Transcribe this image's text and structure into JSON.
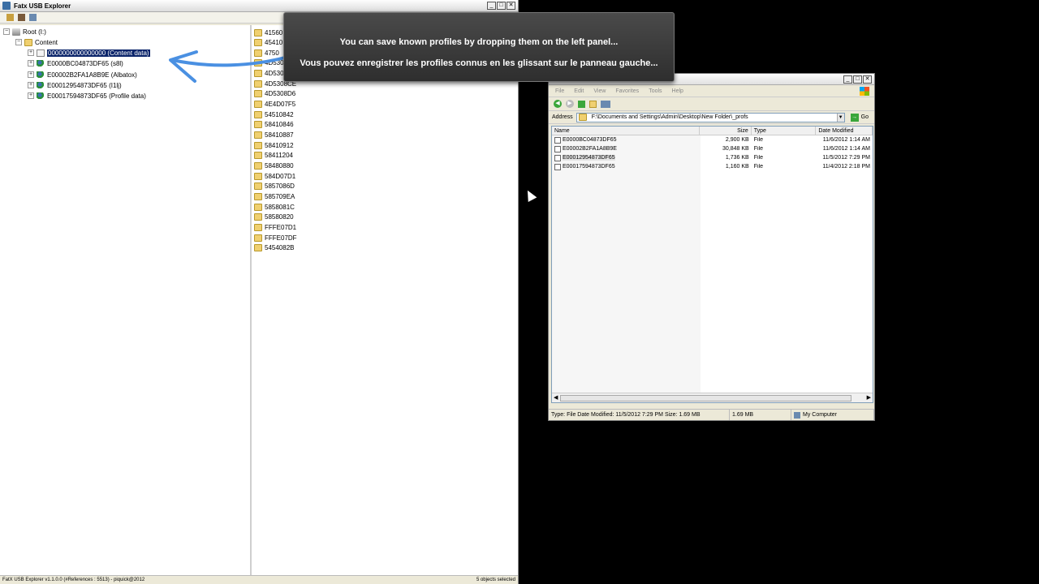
{
  "fatx": {
    "title": "Fatx USB Explorer",
    "tree": {
      "root": "Root (I:)",
      "content": "Content",
      "items": [
        {
          "label": "0000000000000000 (Content data)",
          "icon": "document-icon",
          "selected": true
        },
        {
          "label": "E0000BC04873DF65 (s8l)",
          "icon": "user-icon"
        },
        {
          "label": "E00002B2FA1A8B9E (Albatox)",
          "icon": "user-icon"
        },
        {
          "label": "E00012954873DF65 (I1lj)",
          "icon": "user-icon"
        },
        {
          "label": "E00017594873DF65 (Profile data)",
          "icon": "user-icon"
        }
      ]
    },
    "folders": [
      "41560",
      "45410",
      "4750",
      "4D530",
      "4D530",
      "4D5308CE",
      "4D5308D6",
      "4E4D07F5",
      "54510842",
      "58410846",
      "58410887",
      "58410912",
      "58411204",
      "58480880",
      "584D07D1",
      "5857086D",
      "585709EA",
      "5858081C",
      "58580820",
      "FFFE07D1",
      "FFFE07DF",
      "5454082B"
    ],
    "status_left": "FatX USB Explorer v1.1.0.0 (#References : 5513) - piquick@2012",
    "status_right": "5 objects selected"
  },
  "overlay": {
    "line1": "You can save known profiles by dropping them on the left panel...",
    "line2": "Vous pouvez enregistrer les profiles connus en les glissant sur le panneau gauche..."
  },
  "explorer": {
    "menu": [
      "File",
      "Edit",
      "View",
      "Favorites",
      "Tools",
      "Help"
    ],
    "address_label": "Address",
    "address": "F:\\Documents and Settings\\Admin\\Desktop\\New Folder\\_profs",
    "go": "Go",
    "columns": {
      "name": "Name",
      "size": "Size",
      "type": "Type",
      "date": "Date Modified"
    },
    "files": [
      {
        "name": "E0000BC04873DF65",
        "size": "2,900 KB",
        "type": "File",
        "date": "11/6/2012 1:14 AM"
      },
      {
        "name": "E00002B2FA1A8B9E",
        "size": "30,848 KB",
        "type": "File",
        "date": "11/6/2012 1:14 AM"
      },
      {
        "name": "E00012954873DF65",
        "size": "1,736 KB",
        "type": "File",
        "date": "11/5/2012 7:29 PM",
        "selected": true
      },
      {
        "name": "E00017594873DF65",
        "size": "1,160 KB",
        "type": "File",
        "date": "11/4/2012 2:18 PM"
      }
    ],
    "status": {
      "info": "Type: File Date Modified: 11/5/2012 7:29 PM Size: 1.69 MB",
      "size": "1.69 MB",
      "location": "My Computer"
    }
  },
  "colors": {
    "selection": "#0a246a",
    "arrow": "#4a90e2",
    "overlay": "#3a3a3a"
  }
}
